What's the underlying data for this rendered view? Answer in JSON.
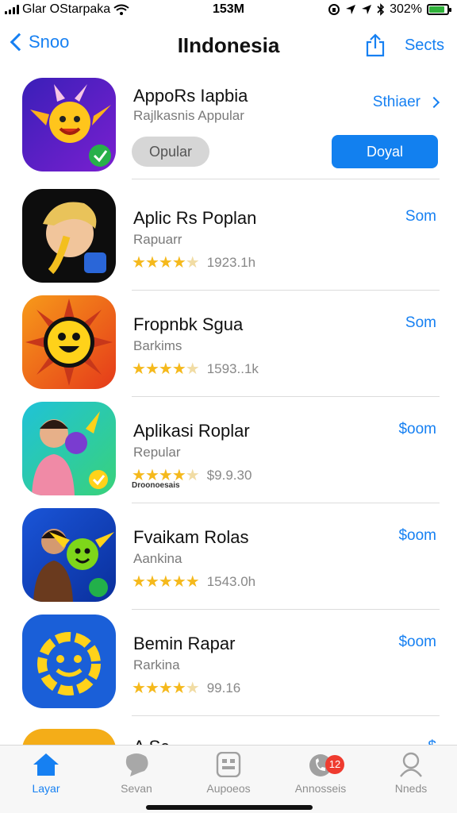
{
  "status": {
    "carrier": "Glar OStarpaka",
    "time": "153M",
    "battery": "302%",
    "battery_level": 0.85
  },
  "nav": {
    "back_label": "Snoo",
    "title": "IIndonesia",
    "select_label": "Sects"
  },
  "featured": {
    "name": "AppoRs Iapbia",
    "subtitle": "Rajlkasnis Appular",
    "pill_label": "Opular",
    "see_all_label": "Sthiaer",
    "get_label": "Doyal"
  },
  "apps": [
    {
      "name": "Aplic Rs Poplan",
      "subtitle": "Rapuarr",
      "rating": 4.5,
      "count": "1923.1h",
      "price": "Som"
    },
    {
      "name": "Fropnbk Sgua",
      "subtitle": "Barkims",
      "rating": 4.5,
      "count": "1593..1k",
      "price": "Som"
    },
    {
      "name": "Aplikasi Roplar",
      "subtitle": "Repular",
      "rating": 4.5,
      "count": "$9.9.30",
      "price": "$oom",
      "extra": "Droonoesais"
    },
    {
      "name": "Fvaikam Rolas",
      "subtitle": "Aankina",
      "rating": 5,
      "count": "1543.0h",
      "price": "$oom"
    },
    {
      "name": "Bemin Rapar",
      "subtitle": "Rarkina",
      "rating": 4.5,
      "count": "99.16",
      "price": "$oom"
    }
  ],
  "partial": {
    "name": "A Sc",
    "price": "$"
  },
  "tabs": [
    {
      "label": "Layar",
      "icon": "home-icon",
      "active": true
    },
    {
      "label": "Sevan",
      "icon": "chat-icon"
    },
    {
      "label": "Aupoeos",
      "icon": "apps-icon"
    },
    {
      "label": "Annosseis",
      "icon": "phone-icon",
      "badge": "12"
    },
    {
      "label": "Nneds",
      "icon": "search-icon"
    }
  ],
  "colors": {
    "accent": "#1680f2",
    "star": "#f5b91c",
    "badge": "#ef3b2f"
  }
}
